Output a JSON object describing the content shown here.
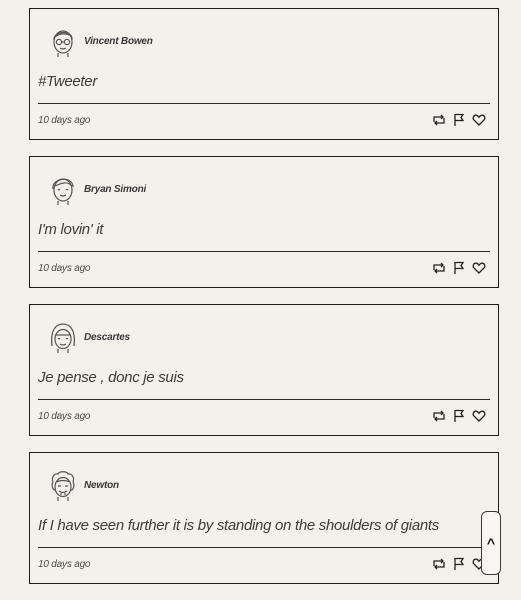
{
  "tweets": [
    {
      "username": "Vincent Bowen",
      "avatar": "glasses-avatar-icon",
      "message": "#Tweeter",
      "timestamp": "10 days ago"
    },
    {
      "username": "Bryan Simoni",
      "avatar": "smiling-man-avatar-icon",
      "message": "I'm lovin' it",
      "timestamp": "10 days ago"
    },
    {
      "username": "Descartes",
      "avatar": "bob-hair-avatar-icon",
      "message": "Je pense , donc je suis",
      "timestamp": "10 days ago"
    },
    {
      "username": "Newton",
      "avatar": "curly-hair-avatar-icon",
      "message": "If I have seen further it is by standing on the shoulders of giants",
      "timestamp": "10 days ago"
    }
  ],
  "actions": [
    "retweet-icon",
    "flag-icon",
    "heart-icon"
  ],
  "scroll_top": {
    "label": "^"
  },
  "colors": {
    "background": "#f2f1ec",
    "border": "#1f1f1f",
    "text": "#3d3d3d"
  }
}
